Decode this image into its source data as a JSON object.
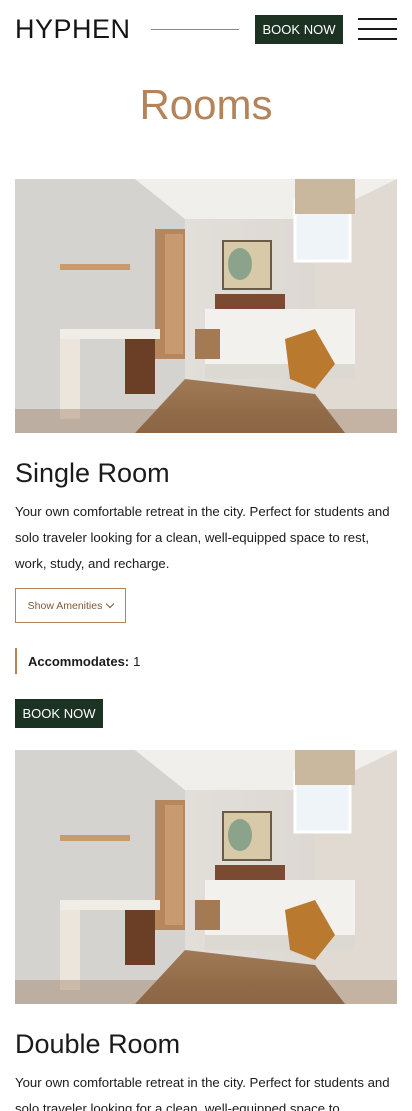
{
  "header": {
    "logo": "HYPHEN",
    "book_now": "BOOK NOW",
    "menu_icon": "hamburger-menu-icon"
  },
  "page": {
    "title": "Rooms"
  },
  "rooms": [
    {
      "name": "Single Room",
      "description": "Your own comfortable retreat in the city. Perfect for students and solo traveler looking for a clean, well-equipped space to rest, work, study, and recharge.",
      "amenities_label": "Show Amenities",
      "accommodates_label": "Accommodates:",
      "accommodates_value": "1",
      "book_label": "BOOK NOW",
      "image_alt": "Single room with desk, bed and window"
    },
    {
      "name": "Double Room",
      "description": "Your own comfortable retreat in the city. Perfect for students and solo traveler looking for a clean, well-equipped space to",
      "image_alt": "Double room with desk, bed and window"
    }
  ],
  "colors": {
    "accent": "#b5835a",
    "button_bg": "#1c3324",
    "text": "#1b1b1b"
  }
}
